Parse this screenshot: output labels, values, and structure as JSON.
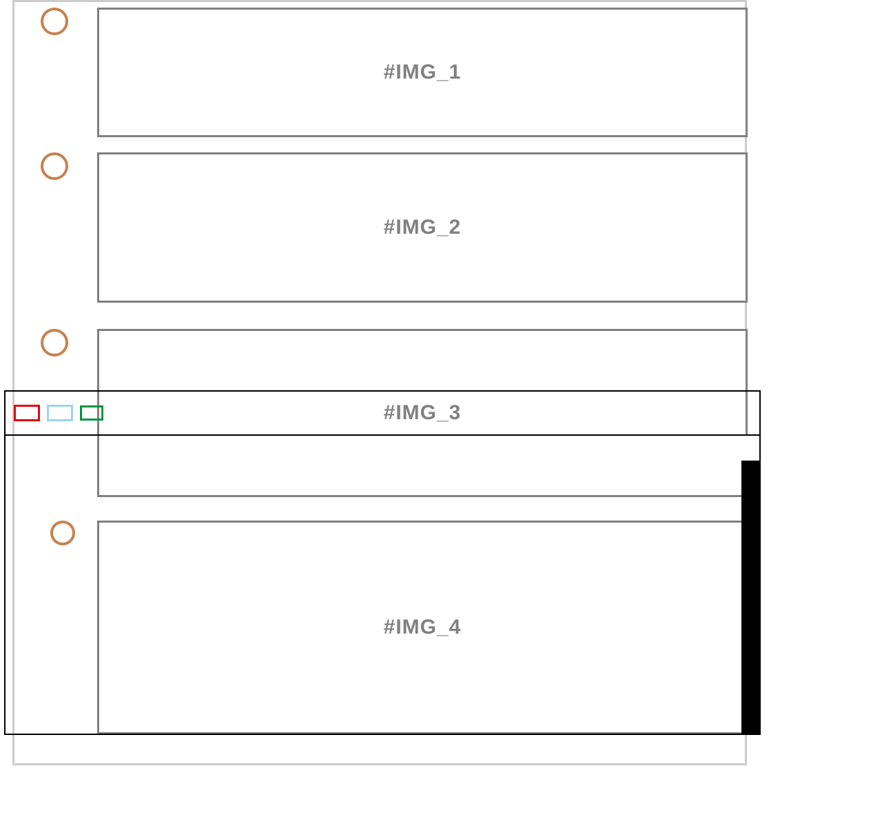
{
  "slots": [
    {
      "label": "#IMG_1"
    },
    {
      "label": "#IMG_2"
    },
    {
      "label": "#IMG_3"
    },
    {
      "label": "#IMG_4"
    }
  ],
  "colors": {
    "circle_stroke": "#c8824e",
    "slot_stroke": "#808080",
    "container_stroke": "#cccccc",
    "win_red": "#e30613",
    "win_blue": "#9fd4e6",
    "win_green": "#009640"
  }
}
